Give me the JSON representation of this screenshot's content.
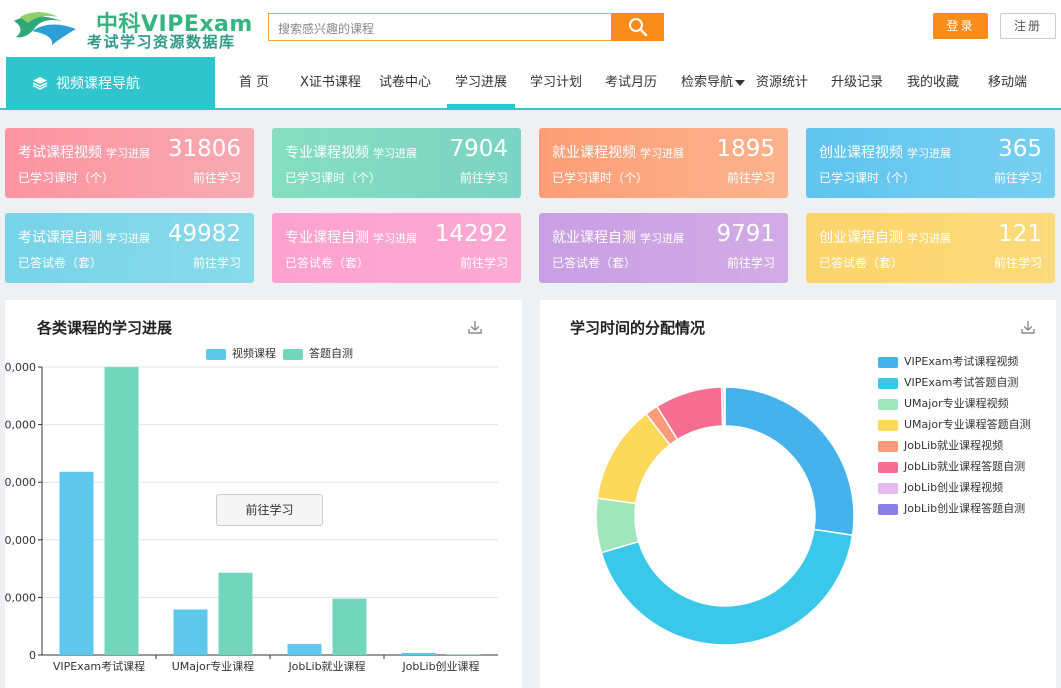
{
  "brand": {
    "name_top": "中科VIPExam",
    "name_bottom": "考试学习资源数据库"
  },
  "search": {
    "placeholder": "搜索感兴趣的课程"
  },
  "auth": {
    "login": "登录",
    "register": "注册"
  },
  "nav": {
    "side_label": "视频课程导航",
    "items": [
      "首 页",
      "X证书课程",
      "试卷中心",
      "学习进展",
      "学习计划",
      "考试月历",
      "检索导航",
      "资源统计",
      "升级记录",
      "我的收藏",
      "移动端"
    ],
    "active": "学习进展"
  },
  "cards": [
    {
      "title": "考试课程视频",
      "tag": "学习进展",
      "value": "31806",
      "sub": "已学习课时（个）",
      "go": "前往学习",
      "color1": "#fd94a1",
      "color2": "#f7aab2"
    },
    {
      "title": "专业课程视频",
      "tag": "学习进展",
      "value": "7904",
      "sub": "已学习课时（个）",
      "go": "前往学习",
      "color1": "#86dec0",
      "color2": "#7bd3c3"
    },
    {
      "title": "就业课程视频",
      "tag": "学习进展",
      "value": "1895",
      "sub": "已学习课时（个）",
      "go": "前往学习",
      "color1": "#fd9e77",
      "color2": "#fcb38d"
    },
    {
      "title": "创业课程视频",
      "tag": "学习进展",
      "value": "365",
      "sub": "已学习课时（个）",
      "go": "前往学习",
      "color1": "#5fc4ef",
      "color2": "#77d0f0"
    },
    {
      "title": "考试课程自测",
      "tag": "学习进展",
      "value": "49982",
      "sub": "已答试卷（套）",
      "go": "前往学习",
      "color1": "#78d3e9",
      "color2": "#88dae9"
    },
    {
      "title": "专业课程自测",
      "tag": "学习进展",
      "value": "14292",
      "sub": "已答试卷（套）",
      "go": "前往学习",
      "color1": "#fda2cf",
      "color2": "#fcaad4"
    },
    {
      "title": "就业课程自测",
      "tag": "学习进展",
      "value": "9791",
      "sub": "已答试卷（套）",
      "go": "前往学习",
      "color1": "#c89fe3",
      "color2": "#d3abe6"
    },
    {
      "title": "创业课程自测",
      "tag": "学习进展",
      "value": "121",
      "sub": "已答试卷（套）",
      "go": "前往学习",
      "color1": "#fbd46b",
      "color2": "#fcdb7d"
    }
  ],
  "bar_panel": {
    "title": "各类课程的学习进展",
    "tooltip_button": "前往学习"
  },
  "pie_panel": {
    "title": "学习时间的分配情况"
  },
  "colors": {
    "accent": "#2ec5cc",
    "orange": "#f98d1c"
  },
  "chart_data": [
    {
      "type": "bar",
      "title": "各类课程的学习进展",
      "categories": [
        "VIPExam考试课程",
        "UMajor专业课程",
        "JobLib就业课程",
        "JobLib创业课程"
      ],
      "series": [
        {
          "name": "视频课程",
          "color": "#5ec8ec",
          "values": [
            31806,
            7904,
            1895,
            365
          ]
        },
        {
          "name": "答题自测",
          "color": "#72d6bd",
          "values": [
            49982,
            14292,
            9791,
            121
          ]
        }
      ],
      "ytick_labels": [
        ",0,000",
        ",0,000",
        ",0,000",
        ",0,000",
        ",0,000",
        "0"
      ],
      "ylim": [
        0,
        50000
      ],
      "grid": true,
      "legend": "top-center"
    },
    {
      "type": "pie",
      "title": "学习时间的分配情况",
      "donut": true,
      "legend": "right",
      "slices": [
        {
          "label": "VIPExam考试课程视频",
          "value": 31806,
          "color": "#45b2ec"
        },
        {
          "label": "VIPExam考试答题自测",
          "value": 49982,
          "color": "#3ac8ea"
        },
        {
          "label": "UMajor专业课程视频",
          "value": 7904,
          "color": "#a0e6bd"
        },
        {
          "label": "UMajor专业课程答题自测",
          "value": 14292,
          "color": "#fcd95a"
        },
        {
          "label": "JobLib就业课程视频",
          "value": 1895,
          "color": "#fb9b7c"
        },
        {
          "label": "JobLib就业课程答题自测",
          "value": 9791,
          "color": "#f66e8f"
        },
        {
          "label": "JobLib创业课程视频",
          "value": 365,
          "color": "#e3baf2"
        },
        {
          "label": "JobLib创业课程答题自测",
          "value": 121,
          "color": "#8a7de8"
        }
      ]
    }
  ]
}
